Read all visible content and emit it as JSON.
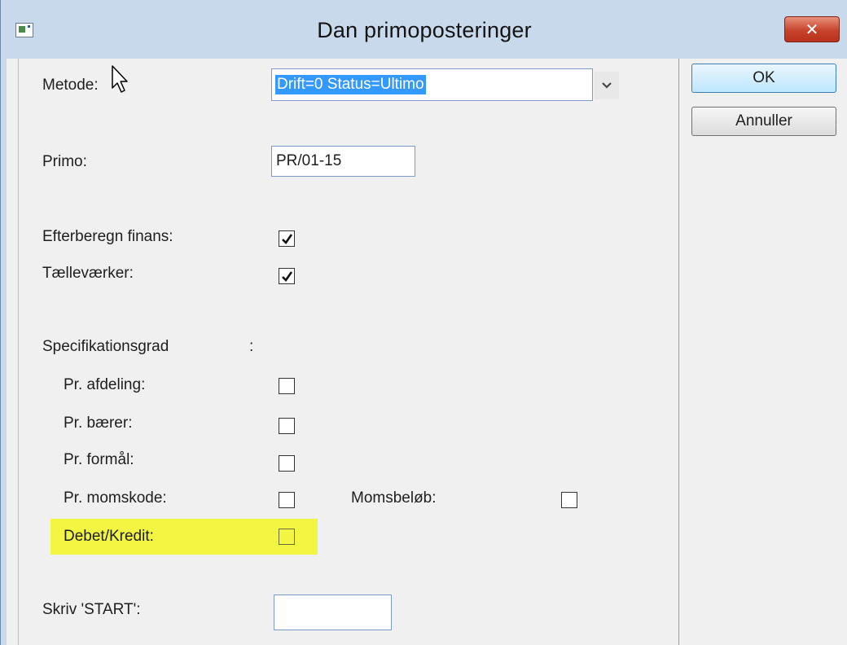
{
  "window": {
    "title": "Dan primoposteringer",
    "close_label": "✕"
  },
  "buttons": {
    "ok_label": "OK",
    "cancel_label": "Annuller"
  },
  "form": {
    "metode_label": "Metode:",
    "metode_value": "Drift=0 Status=Ultimo",
    "primo_label": "Primo:",
    "primo_value": "PR/01-15",
    "efterberegn_label": "Efterberegn finans:",
    "efterberegn_checked": true,
    "taellevaerker_label": "Tælleværker:",
    "taellevaerker_checked": true,
    "specifikationsgrad_label": "Specifikationsgrad",
    "specifikationsgrad_colon": ":",
    "afdeling_label": "Pr. afdeling:",
    "afdeling_checked": false,
    "baerer_label": "Pr. bærer:",
    "baerer_checked": false,
    "formaal_label": "Pr. formål:",
    "formaal_checked": false,
    "momskode_label": "Pr. momskode:",
    "momskode_checked": false,
    "momsbeloeb_label": "Momsbeløb:",
    "momsbeloeb_checked": false,
    "debetkredit_label": "Debet/Kredit:",
    "debetkredit_checked": false,
    "start_label": "Skriv 'START':",
    "start_value": ""
  },
  "colors": {
    "highlight": "#f2f542",
    "selection": "#3399ff",
    "close_button": "#c7432b"
  }
}
